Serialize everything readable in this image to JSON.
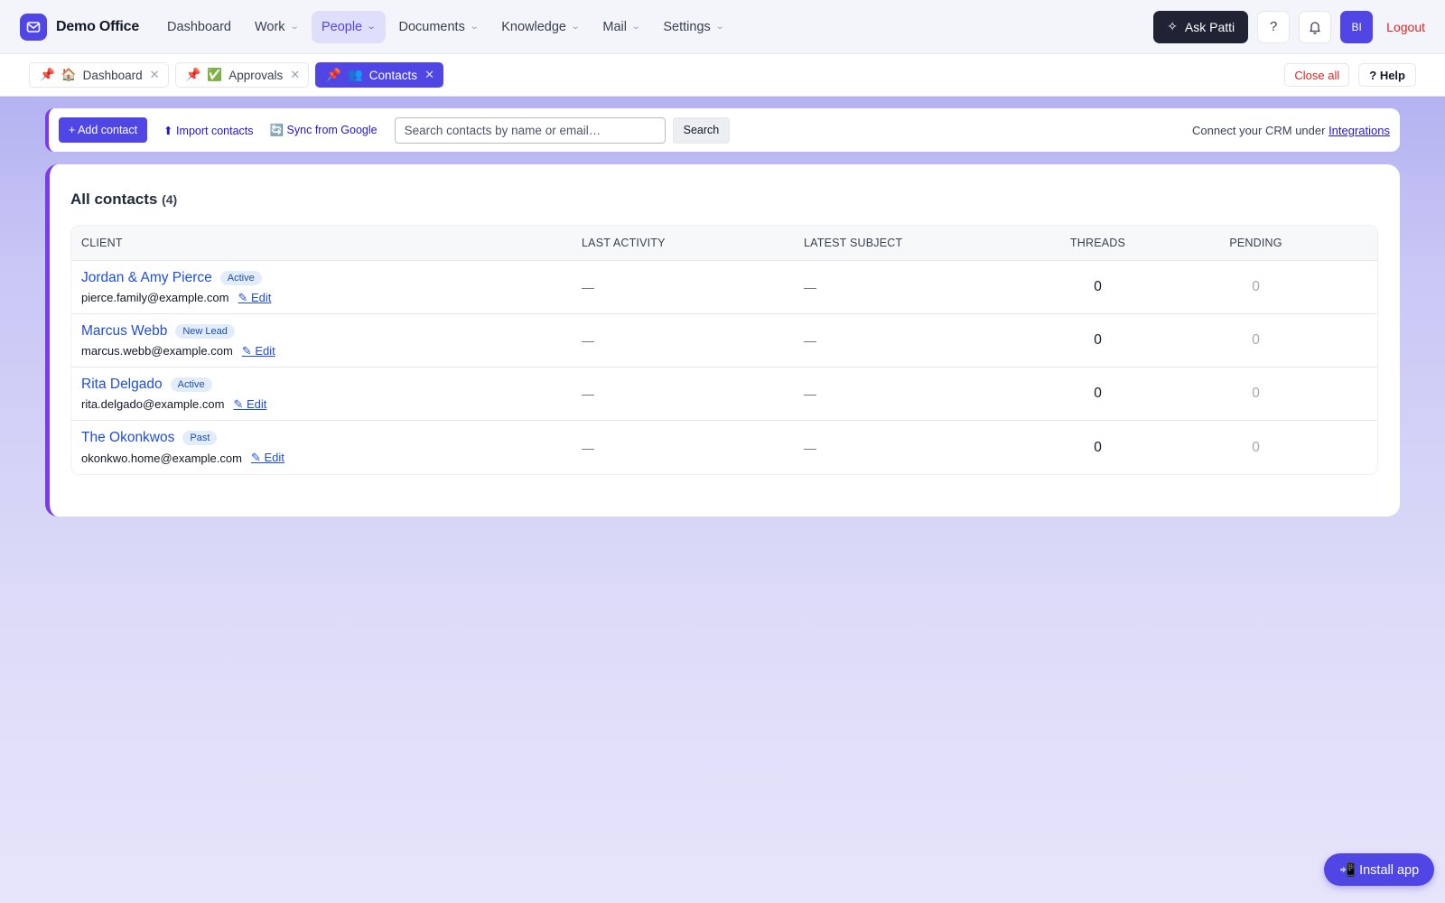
{
  "brand": {
    "name": "Demo Office",
    "logo_icon": "mail-icon"
  },
  "nav": {
    "items": [
      {
        "label": "Dashboard",
        "has_dropdown": false
      },
      {
        "label": "Work",
        "has_dropdown": true
      },
      {
        "label": "People",
        "has_dropdown": true,
        "active": true
      },
      {
        "label": "Documents",
        "has_dropdown": true
      },
      {
        "label": "Knowledge",
        "has_dropdown": true
      },
      {
        "label": "Mail",
        "has_dropdown": true
      },
      {
        "label": "Settings",
        "has_dropdown": true
      }
    ],
    "ask_label": "Ask Patti",
    "help_glyph": "?",
    "avatar_initials": "BI",
    "logout_label": "Logout"
  },
  "tabs": {
    "items": [
      {
        "pin": "📌",
        "emoji": "🏠",
        "label": "Dashboard",
        "active": false
      },
      {
        "pin": "📌",
        "emoji": "✅",
        "label": "Approvals",
        "active": false
      },
      {
        "pin": "📌",
        "emoji": "👥",
        "label": "Contacts",
        "active": true
      }
    ],
    "close_all_label": "Close all",
    "help_label": "? Help"
  },
  "toolbar": {
    "add_label": "+ Add contact",
    "import_label": "⬆ Import contacts",
    "sync_label": "🔄 Sync from Google",
    "search_placeholder": "Search contacts by name or email…",
    "search_button": "Search",
    "crm_text": "Connect your CRM under ",
    "crm_link": "Integrations"
  },
  "contacts": {
    "title": "All contacts",
    "count": "(4)",
    "columns": [
      "CLIENT",
      "LAST ACTIVITY",
      "LATEST SUBJECT",
      "THREADS",
      "PENDING"
    ],
    "edit_label": "✎ Edit",
    "rows": [
      {
        "name": "Jordan & Amy Pierce",
        "status": "Active",
        "email": "pierce.family@example.com",
        "last_activity": "—",
        "latest_subject": "—",
        "threads": "0",
        "pending": "0"
      },
      {
        "name": "Marcus Webb",
        "status": "New Lead",
        "email": "marcus.webb@example.com",
        "last_activity": "—",
        "latest_subject": "—",
        "threads": "0",
        "pending": "0"
      },
      {
        "name": "Rita Delgado",
        "status": "Active",
        "email": "rita.delgado@example.com",
        "last_activity": "—",
        "latest_subject": "—",
        "threads": "0",
        "pending": "0"
      },
      {
        "name": "The Okonkwos",
        "status": "Past",
        "email": "okonkwo.home@example.com",
        "last_activity": "—",
        "latest_subject": "—",
        "threads": "0",
        "pending": "0"
      }
    ]
  },
  "install": {
    "label": "📲 Install app"
  },
  "colors": {
    "accent": "#4f46e5",
    "accent_border": "#7c3aed",
    "danger": "#dc2626",
    "link": "#1d4ed8"
  }
}
